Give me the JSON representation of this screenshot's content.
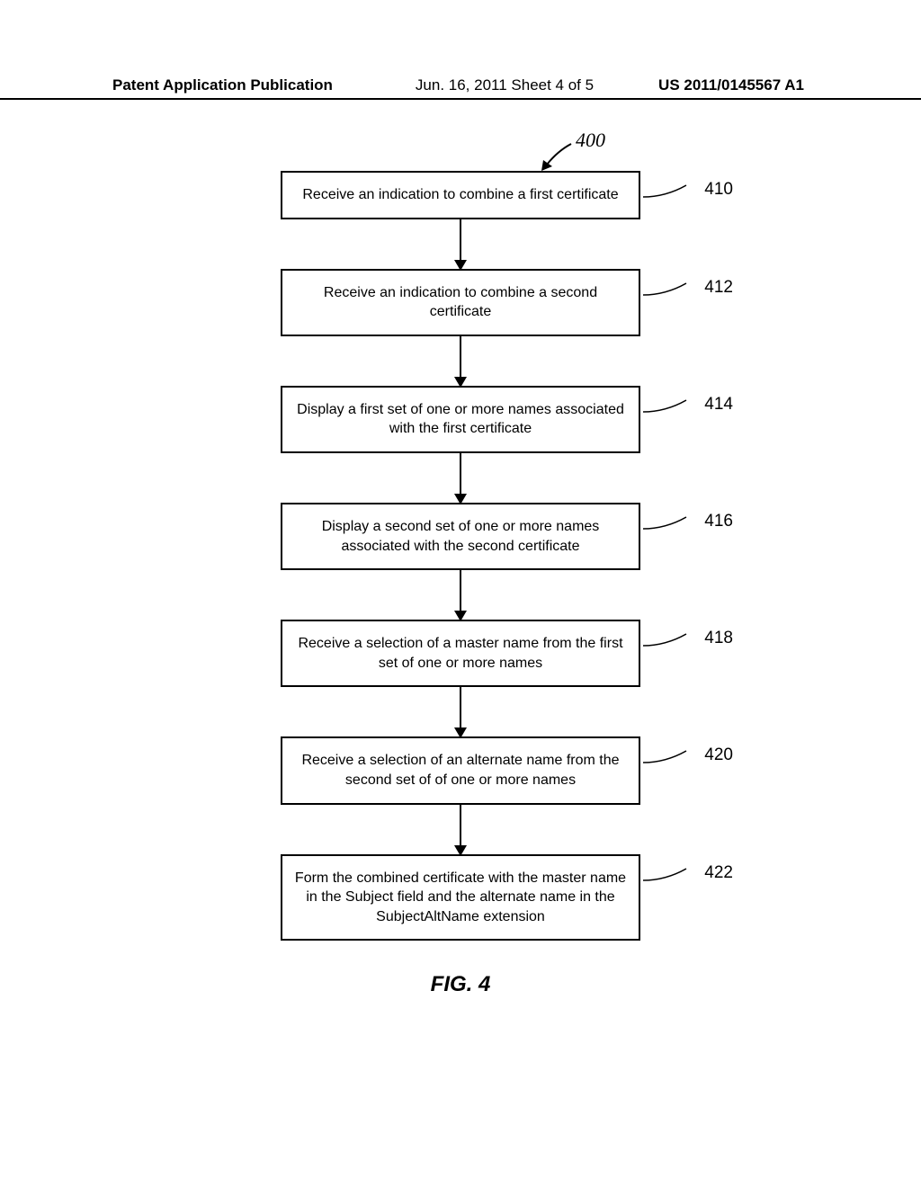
{
  "header": {
    "left": "Patent Application Publication",
    "center": "Jun. 16, 2011  Sheet 4 of 5",
    "right": "US 2011/0145567 A1"
  },
  "figure_number": "400",
  "boxes": [
    {
      "label": "410",
      "text": "Receive an indication to combine a first certificate"
    },
    {
      "label": "412",
      "text": "Receive an indication to combine a second certificate"
    },
    {
      "label": "414",
      "text": "Display a first set of one or more names associated with the first certificate"
    },
    {
      "label": "416",
      "text": "Display a second set of one or more names associated with the second certificate"
    },
    {
      "label": "418",
      "text": "Receive a selection of a master name from the first set of one or more names"
    },
    {
      "label": "420",
      "text": "Receive a selection of an alternate name from the second set of of one or more names"
    },
    {
      "label": "422",
      "text": "Form the combined certificate with the master name in the Subject field and the alternate name in the SubjectAltName extension"
    }
  ],
  "figure_caption": "FIG. 4"
}
